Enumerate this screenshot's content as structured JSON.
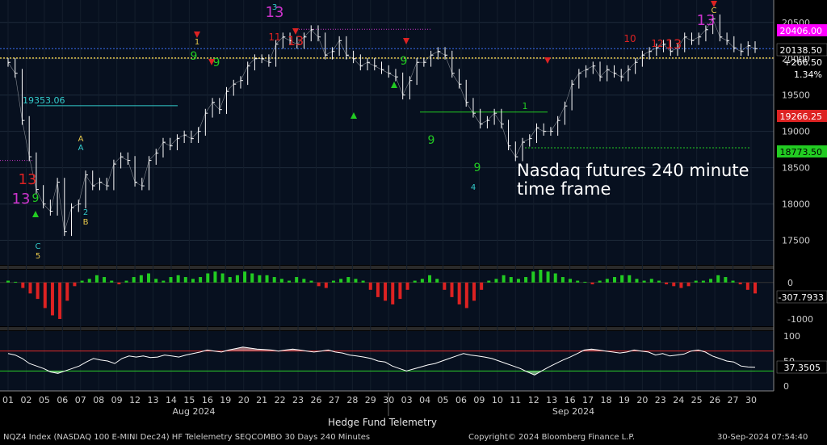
{
  "annotation": {
    "line1": "Nasdaq futures 240 minute",
    "line2": "time frame"
  },
  "footer": {
    "left": "NQZ4 Index (NASDAQ 100 E-MINI Dec24) HF Telelemetry SEQCOMBO 30 Days 240 Minutes",
    "center": "Copyright© 2024 Bloomberg Finance L.P.",
    "right": "30-Sep-2024 07:54:40",
    "telemetry": "Hedge Fund Telemetry"
  },
  "colors": {
    "background": "#000000",
    "panel": "#07101f",
    "grid": "#1e2a3a",
    "candle": "#ffffff",
    "buy": "#22cc22",
    "sell": "#dd2222",
    "thirteen": "#cc33cc",
    "cyan": "#33cccc",
    "yellow": "#e8c84a",
    "magenta": "#ff00ff",
    "axis": "#cccccc",
    "rsi_line": "#ffffff"
  },
  "chart_data": [
    {
      "type": "line",
      "title": "",
      "price_axis": {
        "ticks": [
          17500,
          18000,
          18500,
          19000,
          19500,
          20000,
          20500
        ],
        "ylim": [
          17250,
          20720
        ]
      },
      "x_ticks": [
        "01",
        "02",
        "05",
        "06",
        "07",
        "08",
        "09",
        "12",
        "13",
        "14",
        "15",
        "16",
        "19",
        "20",
        "21",
        "22",
        "23",
        "26",
        "27",
        "28",
        "29",
        "30",
        "03",
        "04",
        "05",
        "06",
        "09",
        "10",
        "11",
        "12",
        "13",
        "16",
        "17",
        "18",
        "19",
        "20",
        "23",
        "24",
        "25",
        "26",
        "27",
        "30"
      ],
      "month_labels": [
        "Aug 2024",
        "Sep 2024"
      ],
      "series": [
        {
          "values": [
            19950,
            19800,
            19150,
            18650,
            18200,
            18000,
            17900,
            18300,
            17620,
            17950,
            18000,
            18400,
            18250,
            18300,
            18250,
            18550,
            18650,
            18600,
            18300,
            18250,
            18600,
            18700,
            18850,
            18800,
            18900,
            18950,
            18900,
            19000,
            19250,
            19400,
            19300,
            19550,
            19650,
            19700,
            19900,
            20000,
            20000,
            19950,
            20200,
            20300,
            20250,
            20200,
            20300,
            20400,
            20300,
            20050,
            20100,
            20250,
            20050,
            20000,
            19900,
            19950,
            19900,
            19850,
            19800,
            19750,
            19500,
            19700,
            19950,
            19950,
            20050,
            20100,
            20050,
            19800,
            19650,
            19400,
            19250,
            19100,
            19150,
            19250,
            19100,
            18800,
            18650,
            18850,
            18900,
            19050,
            19000,
            19000,
            19150,
            19350,
            19650,
            19800,
            19850,
            19900,
            19750,
            19850,
            19800,
            19750,
            19850,
            19950,
            20050,
            20100,
            20150,
            20200,
            20100,
            20150,
            20300,
            20250,
            20300,
            20400,
            20550,
            20300,
            20250,
            20150,
            20100,
            20180,
            20138.5
          ]
        }
      ],
      "price_labels": [
        {
          "value": "20406.00",
          "bg": "#ff00ff",
          "fg": "#ffffff"
        },
        {
          "value": "20138.50",
          "bg": "#000000",
          "fg": "#ffffff"
        },
        {
          "value": "+266.50",
          "bg": "#000000",
          "fg": "#ffffff"
        },
        {
          "value": "1.34%",
          "bg": "#000000",
          "fg": "#ffffff"
        },
        {
          "value": "19266.25",
          "bg": "#dd2222",
          "fg": "#ffffff"
        },
        {
          "value": "18773.50",
          "bg": "#22cc22",
          "fg": "#000000"
        }
      ],
      "level_lines": [
        {
          "value": 19353.06,
          "label": "19353.06",
          "color": "#33cccc"
        },
        {
          "value": 20406,
          "color": "#cc33cc"
        },
        {
          "value": 20138.5,
          "color": "#3a6df0"
        },
        {
          "value": 20010,
          "color": "#e8c84a"
        },
        {
          "value": 19266.25,
          "color": "#22cc22"
        },
        {
          "value": 18773.5,
          "color": "#22cc22"
        },
        {
          "value": 18600,
          "color": "#cc33cc"
        }
      ],
      "setup_labels": [
        {
          "text": "13",
          "color": "#cc33cc"
        },
        {
          "text": "13",
          "color": "#dd2222"
        },
        {
          "text": "13",
          "color": "#cc33cc"
        },
        {
          "text": "13",
          "color": "#cc33cc"
        },
        {
          "text": "9",
          "color": "#22cc22"
        },
        {
          "text": "9",
          "color": "#22cc22"
        },
        {
          "text": "9",
          "color": "#22cc22"
        },
        {
          "text": "9",
          "color": "#22cc22"
        },
        {
          "text": "9",
          "color": "#22cc22"
        },
        {
          "text": "9",
          "color": "#22cc22"
        },
        {
          "text": "10",
          "color": "#dd2222"
        },
        {
          "text": "12",
          "color": "#dd2222"
        },
        {
          "text": "13",
          "color": "#dd2222"
        },
        {
          "text": "11",
          "color": "#dd2222"
        },
        {
          "text": "13",
          "color": "#dd2222"
        },
        {
          "text": "C",
          "color": "#e8c84a"
        },
        {
          "text": "C",
          "color": "#33cccc"
        },
        {
          "text": "5",
          "color": "#e8c84a"
        },
        {
          "text": "A",
          "color": "#e8c84a"
        },
        {
          "text": "A",
          "color": "#33cccc"
        },
        {
          "text": "B",
          "color": "#e8c84a"
        },
        {
          "text": "3",
          "color": "#33cccc"
        },
        {
          "text": "4",
          "color": "#33cccc"
        },
        {
          "text": "1",
          "color": "#e8c84a"
        },
        {
          "text": "1",
          "color": "#22cc22"
        },
        {
          "text": "2",
          "color": "#33cccc"
        }
      ]
    },
    {
      "type": "bar",
      "title": "",
      "ticks": [
        0,
        -1000
      ],
      "ylim": [
        -1200,
        350
      ],
      "last_value": "-307.7933",
      "values": [
        50,
        20,
        -150,
        -300,
        -450,
        -700,
        -900,
        -1000,
        -500,
        -100,
        50,
        100,
        200,
        150,
        50,
        -50,
        50,
        150,
        200,
        250,
        100,
        50,
        150,
        200,
        150,
        100,
        150,
        250,
        300,
        250,
        150,
        200,
        300,
        250,
        200,
        200,
        150,
        100,
        50,
        150,
        100,
        50,
        -100,
        -150,
        50,
        100,
        150,
        100,
        50,
        -200,
        -400,
        -500,
        -600,
        -450,
        -200,
        50,
        100,
        200,
        100,
        -200,
        -400,
        -600,
        -700,
        -500,
        -200,
        50,
        100,
        200,
        150,
        100,
        150,
        300,
        350,
        300,
        250,
        150,
        100,
        50,
        20,
        -50,
        50,
        100,
        150,
        200,
        200,
        100,
        50,
        100,
        50,
        -50,
        -100,
        -150,
        -100,
        50,
        50,
        100,
        200,
        150,
        50,
        -50,
        -200,
        -300
      ]
    },
    {
      "type": "line",
      "title": "",
      "ticks": [
        0,
        50,
        100
      ],
      "ylim": [
        -10,
        110
      ],
      "last_value": "37.3505",
      "upper_level": 70,
      "lower_level": 30,
      "values": [
        65,
        62,
        55,
        45,
        40,
        35,
        28,
        25,
        30,
        35,
        40,
        48,
        55,
        52,
        50,
        45,
        55,
        60,
        58,
        60,
        57,
        58,
        62,
        60,
        58,
        62,
        65,
        68,
        72,
        70,
        68,
        72,
        75,
        78,
        76,
        74,
        73,
        72,
        70,
        72,
        74,
        72,
        70,
        68,
        70,
        72,
        68,
        66,
        62,
        60,
        58,
        55,
        50,
        48,
        40,
        35,
        30,
        34,
        38,
        42,
        45,
        50,
        55,
        60,
        65,
        62,
        60,
        58,
        55,
        50,
        45,
        40,
        35,
        28,
        22,
        30,
        38,
        45,
        52,
        58,
        65,
        72,
        74,
        72,
        70,
        68,
        66,
        68,
        72,
        70,
        68,
        62,
        65,
        60,
        62,
        64,
        70,
        72,
        68,
        60,
        55,
        50,
        48,
        40,
        38,
        37.3505
      ]
    }
  ]
}
